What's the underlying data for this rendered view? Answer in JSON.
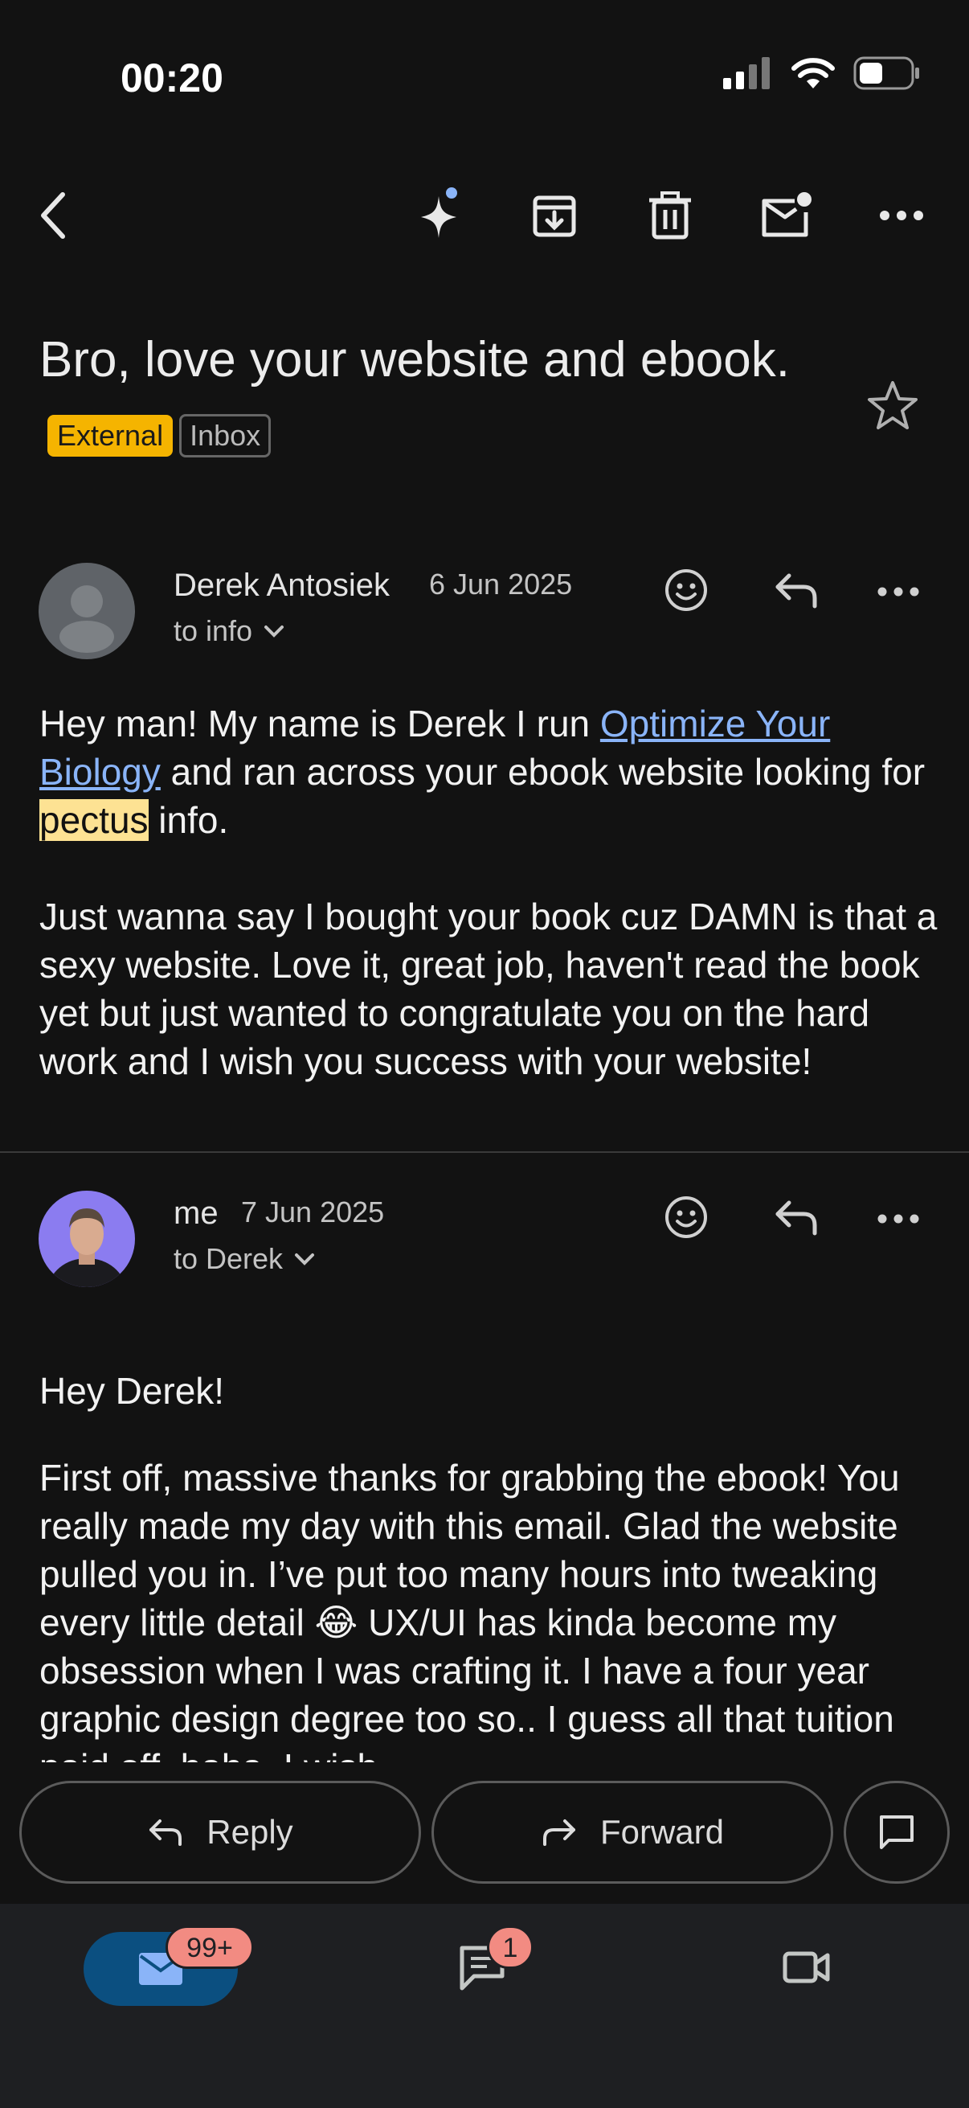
{
  "status_bar": {
    "time": "00:20"
  },
  "toolbar": {
    "back_icon": "chevron-left-icon",
    "actions": [
      "sparkle-icon",
      "archive-icon",
      "trash-icon",
      "mark-unread-icon",
      "more-icon"
    ]
  },
  "subject": {
    "text": "Bro, love your website and ebook.",
    "label_external": "External",
    "label_inbox": "Inbox"
  },
  "messages": [
    {
      "sender": "Derek Antosiek",
      "date": "6 Jun 2025",
      "to": "to info",
      "body": {
        "p1_a": "Hey man! My name is Derek I run ",
        "p1_link": "Optimize Your Biology",
        "p1_b": " and ran across your ebook website looking for ",
        "p1_highlight": "pectus",
        "p1_c": " info.",
        "p2": "Just wanna say I bought your book cuz DAMN is that a sexy website. Love it, great job, haven't read the book yet but just wanted to congratulate you on the hard work and I wish you success with your website!"
      }
    },
    {
      "sender": "me",
      "date": "7 Jun 2025",
      "to": "to Derek",
      "body": {
        "p1": "Hey Derek!",
        "p2_a": "First off, massive thanks for grabbing the ebook! You really made my day with this email. Glad the website pulled you in. I’ve put too many hours into tweaking every little detail ",
        "p2_emoji": "😂",
        "p2_b": " UX/UI has kinda become my obsession when I was crafting it. I have a four year graphic design degree too so.. I guess all that tuition paid off, haha. I wish"
      }
    }
  ],
  "actions": {
    "reply": "Reply",
    "forward": "Forward"
  },
  "bottom_nav": {
    "mail_badge": "99+",
    "chat_badge": "1"
  },
  "colors": {
    "background": "#121212",
    "link": "#8ab4f8",
    "external_badge": "#f5b400",
    "highlight": "#fde293",
    "nav_badge": "#f28b82",
    "mail_active": "#0b4f80"
  }
}
